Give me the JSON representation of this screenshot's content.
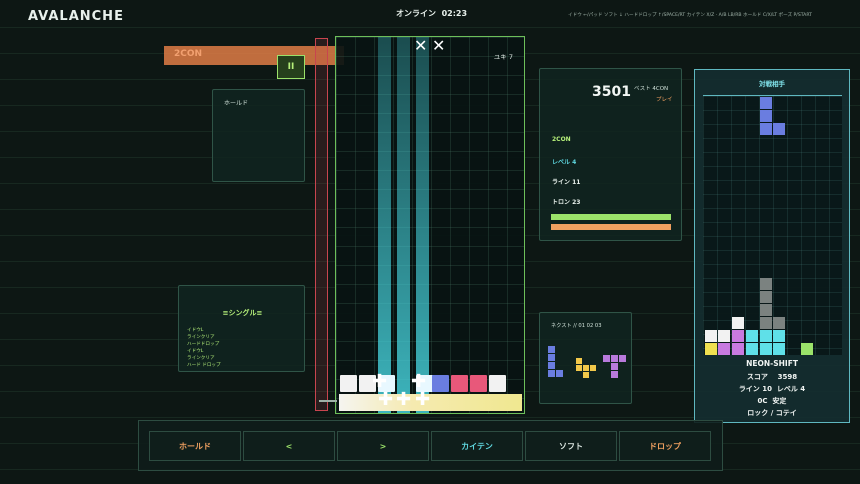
{
  "header": {
    "title": "AVALANCHE",
    "status": "オンライン  02:23",
    "hints": "イドウ ←/パッド  ソフト ↓  ハードドロップ ↑/SPACE/RT  カイテン X/Z · A/B  LB/RB  ホールド C/X/LT  ポーズ P/START"
  },
  "banner": {
    "text": "2CON",
    "pause_label": "II"
  },
  "hold": {
    "label": "ホールド"
  },
  "well": {
    "counter": "ユキ 7",
    "close_icons": [
      "close-icon",
      "close-icon"
    ]
  },
  "stats": {
    "score": "3501",
    "best": "ベスト 4CON",
    "mode": "プレイ",
    "combo": "2CON",
    "level": "レベル 4",
    "lines": "ライン 11",
    "tron": "トロン 23",
    "bars": [
      {
        "color": "#9be26a",
        "fill": 1.0
      },
      {
        "color": "#f0a060",
        "fill": 1.0
      }
    ]
  },
  "log": {
    "title": "≡シングル≡",
    "entries": [
      "イドウL",
      "ラインクリア",
      "ハードドロップ",
      "イドウL",
      "ラインクリア",
      "ハード ドロップ"
    ]
  },
  "next": {
    "label": "ネクスト // 01 02 03"
  },
  "opponent": {
    "title": "対戦相手",
    "name": "NEON-SHIFT",
    "score_line": "スコア    3598",
    "lines_line": "ライン 10  レベル 4",
    "state_line": "0C  安定",
    "lock_line": "ロック / コテイ"
  },
  "controls": [
    {
      "label": "ホールド",
      "color": "#f0a060"
    },
    {
      "label": "<",
      "color": "#9be26a"
    },
    {
      "label": ">",
      "color": "#9be26a"
    },
    {
      "label": "カイテン",
      "color": "#5fd8e0"
    },
    {
      "label": "ソフト",
      "color": "#dfe9e4"
    },
    {
      "label": "ドロップ",
      "color": "#f0a060"
    }
  ],
  "colors": {
    "accent": "#9be26a",
    "cyan": "#5fd8e0",
    "orange": "#f0a060",
    "danger": "#c8454f"
  }
}
